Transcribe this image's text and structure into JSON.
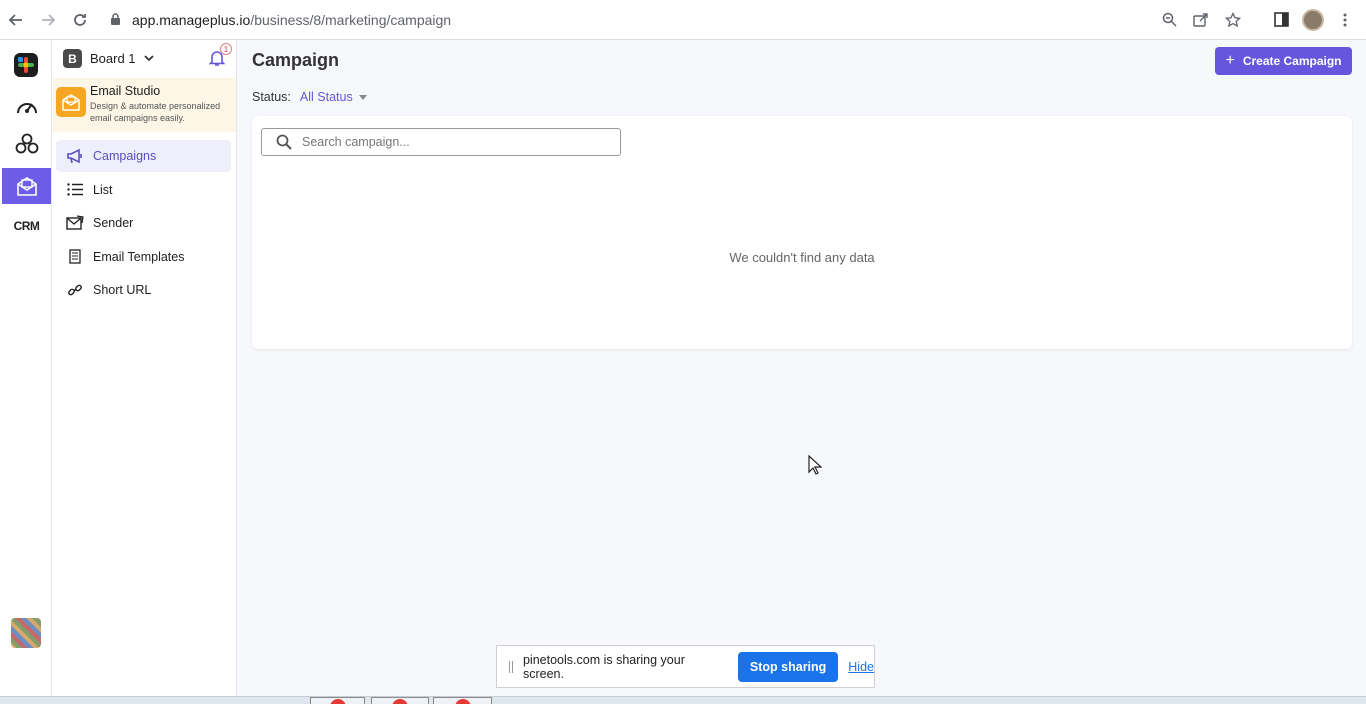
{
  "browser": {
    "url_host": "app.manageplus.io",
    "url_path": "/business/8/marketing/campaign"
  },
  "board": {
    "badge": "B",
    "name": "Board 1",
    "notification_count": "1"
  },
  "studio": {
    "title": "Email Studio",
    "description": "Design & automate personalized email campaigns easily."
  },
  "menu": {
    "items": [
      {
        "label": "Campaigns"
      },
      {
        "label": "List"
      },
      {
        "label": "Sender"
      },
      {
        "label": "Email Templates"
      },
      {
        "label": "Short URL"
      }
    ]
  },
  "rail": {
    "crm_label": "CRM"
  },
  "main": {
    "title": "Campaign",
    "create_button": "Create Campaign",
    "status_label": "Status:",
    "status_value": "All Status",
    "search_placeholder": "Search campaign...",
    "empty_message": "We couldn't find any data"
  },
  "share_bar": {
    "message": "pinetools.com is sharing your screen.",
    "stop_label": "Stop sharing",
    "hide_label": "Hide"
  },
  "colors": {
    "accent": "#6656de",
    "rail_active": "#6c5ce7",
    "studio_bg": "#fdf6e6",
    "share_button": "#1a73e8"
  }
}
